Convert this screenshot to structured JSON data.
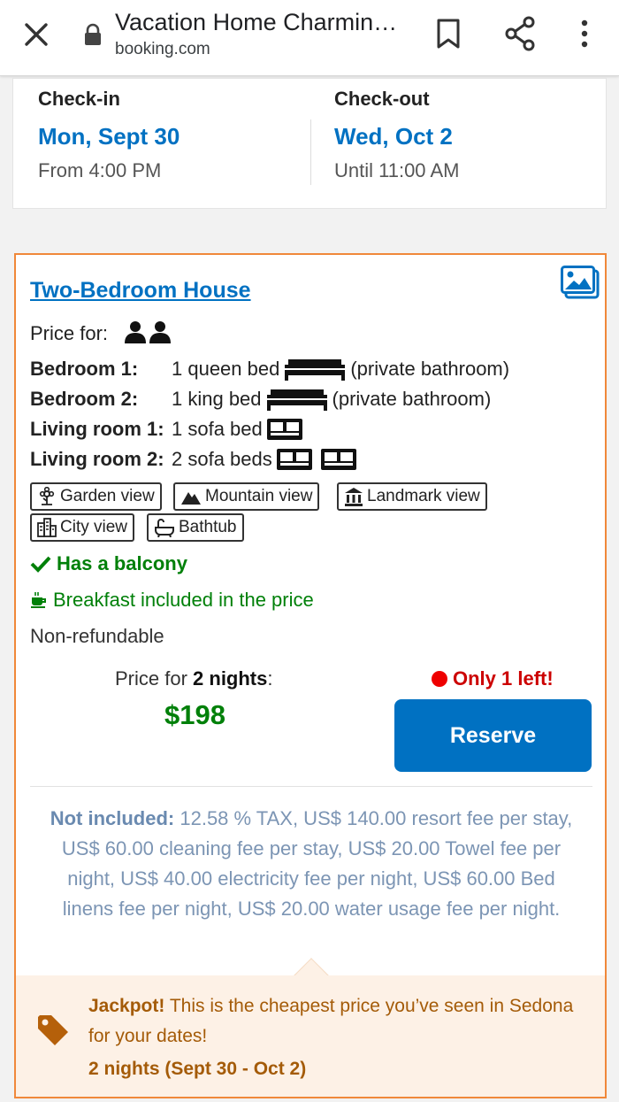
{
  "browser": {
    "title": "Vacation Home Charmin…",
    "url": "booking.com"
  },
  "checkin": {
    "label": "Check-in",
    "date": "Mon, Sept 30",
    "time": "From 4:00 PM"
  },
  "checkout": {
    "label": "Check-out",
    "date": "Wed, Oct 2",
    "time": "Until 11:00 AM"
  },
  "room": {
    "title": "Two-Bedroom House",
    "price_for_label": "Price for:",
    "beds": [
      {
        "label": "Bedroom 1:",
        "value": "1 queen bed",
        "suffix": "(private bathroom)"
      },
      {
        "label": "Bedroom 2:",
        "value": "1 king bed",
        "suffix": "(private bathroom)"
      },
      {
        "label": "Living room 1:",
        "value": "1 sofa bed",
        "suffix": ""
      },
      {
        "label": "Living room 2:",
        "value": "2 sofa beds",
        "suffix": ""
      }
    ],
    "tags": [
      "Garden view",
      "Mountain view",
      "Landmark view",
      "City view",
      "Bathtub"
    ],
    "balcony": "Has a balcony",
    "breakfast": "Breakfast included in the price",
    "refund": "Non-refundable",
    "price_label_prefix": "Price for ",
    "price_label_nights": "2 nights",
    "price_label_suffix": ":",
    "price": "$198",
    "availability": "Only 1 left!",
    "reserve_label": "Reserve",
    "not_included_label": "Not included:",
    "not_included_text": " 12.58 % TAX, US$ 140.00 resort fee per stay, US$ 60.00 cleaning fee per stay, US$ 20.00 Towel fee per night, US$ 40.00 electricity fee per night, US$ 60.00 Bed linens fee per night, US$ 20.00 water usage fee per night."
  },
  "jackpot": {
    "bold": "Jackpot!",
    "text": " This is the cheapest price you’ve seen in Sedona for your dates!",
    "dates": "2 nights (Sept 30 - Oct 2)"
  },
  "colors": {
    "brand_blue": "#0071c2",
    "green": "#008009",
    "orange_border": "#f0883a",
    "jackpot_bg": "#fdf1e6"
  }
}
